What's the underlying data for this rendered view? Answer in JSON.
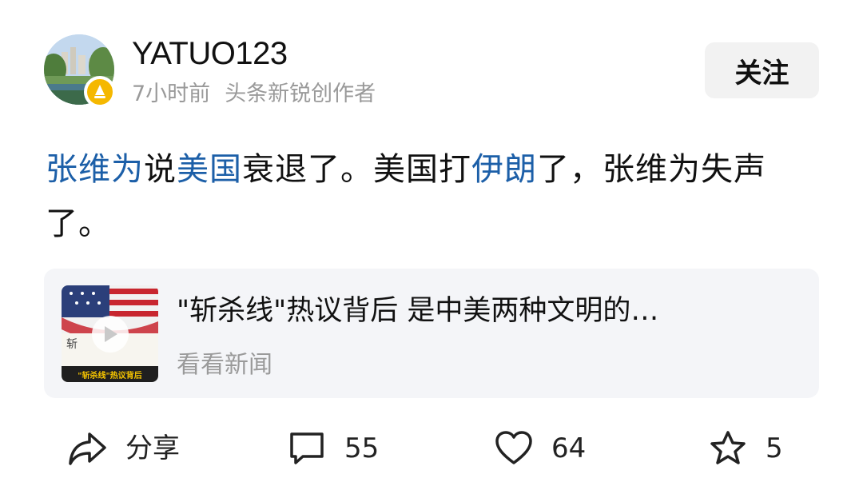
{
  "header": {
    "username": "YATUO123",
    "time": "7小时前",
    "creator_tag": "头条新锐创作者",
    "follow_label": "关注"
  },
  "post": {
    "segments": [
      {
        "text": "张维为",
        "link": true
      },
      {
        "text": "说",
        "link": false
      },
      {
        "text": "美国",
        "link": true
      },
      {
        "text": "衰退了。美国打",
        "link": false
      },
      {
        "text": "伊朗",
        "link": true
      },
      {
        "text": "了，张维为失声了。",
        "link": false
      }
    ]
  },
  "news_card": {
    "title": "\"斩杀线\"热议背后 是中美两种文明的…",
    "source": "看看新闻",
    "thumbnail_caption": "\"斩杀线\"热议背后"
  },
  "actions": {
    "share_label": "分享",
    "comment_count": "55",
    "like_count": "64",
    "favorite_count": "5"
  },
  "colors": {
    "link": "#1c5fa8",
    "meta_text": "#9a9a9a",
    "badge": "#f5b800",
    "card_bg": "#f4f5f8",
    "button_bg": "#f2f2f2"
  },
  "icons": {
    "share": "share-arrow-icon",
    "comment": "comment-bubble-icon",
    "like": "heart-icon",
    "favorite": "star-icon",
    "badge": "creator-badge-icon",
    "play": "play-icon"
  }
}
